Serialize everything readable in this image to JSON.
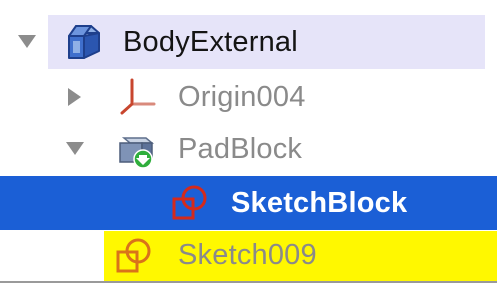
{
  "tree": {
    "items": [
      {
        "label": "BodyExternal",
        "icon": "body-cube-icon",
        "expanded": true,
        "state": "active-body"
      },
      {
        "label": "Origin004",
        "icon": "origin-axes-icon",
        "expanded": false,
        "state": "normal"
      },
      {
        "label": "PadBlock",
        "icon": "pad-feature-icon",
        "expanded": true,
        "state": "normal"
      },
      {
        "label": "SketchBlock",
        "icon": "sketch-icon",
        "state": "selected"
      },
      {
        "label": "Sketch009",
        "icon": "sketch-icon",
        "state": "highlighted"
      }
    ]
  },
  "colors": {
    "active_body_bg": "#e6e4f9",
    "selection_bg": "#1b5fd6",
    "highlight_bg": "#fff800",
    "sketch_red": "#d42a1c",
    "sketch_orange": "#d9731a",
    "origin_red": "#c8462e"
  }
}
